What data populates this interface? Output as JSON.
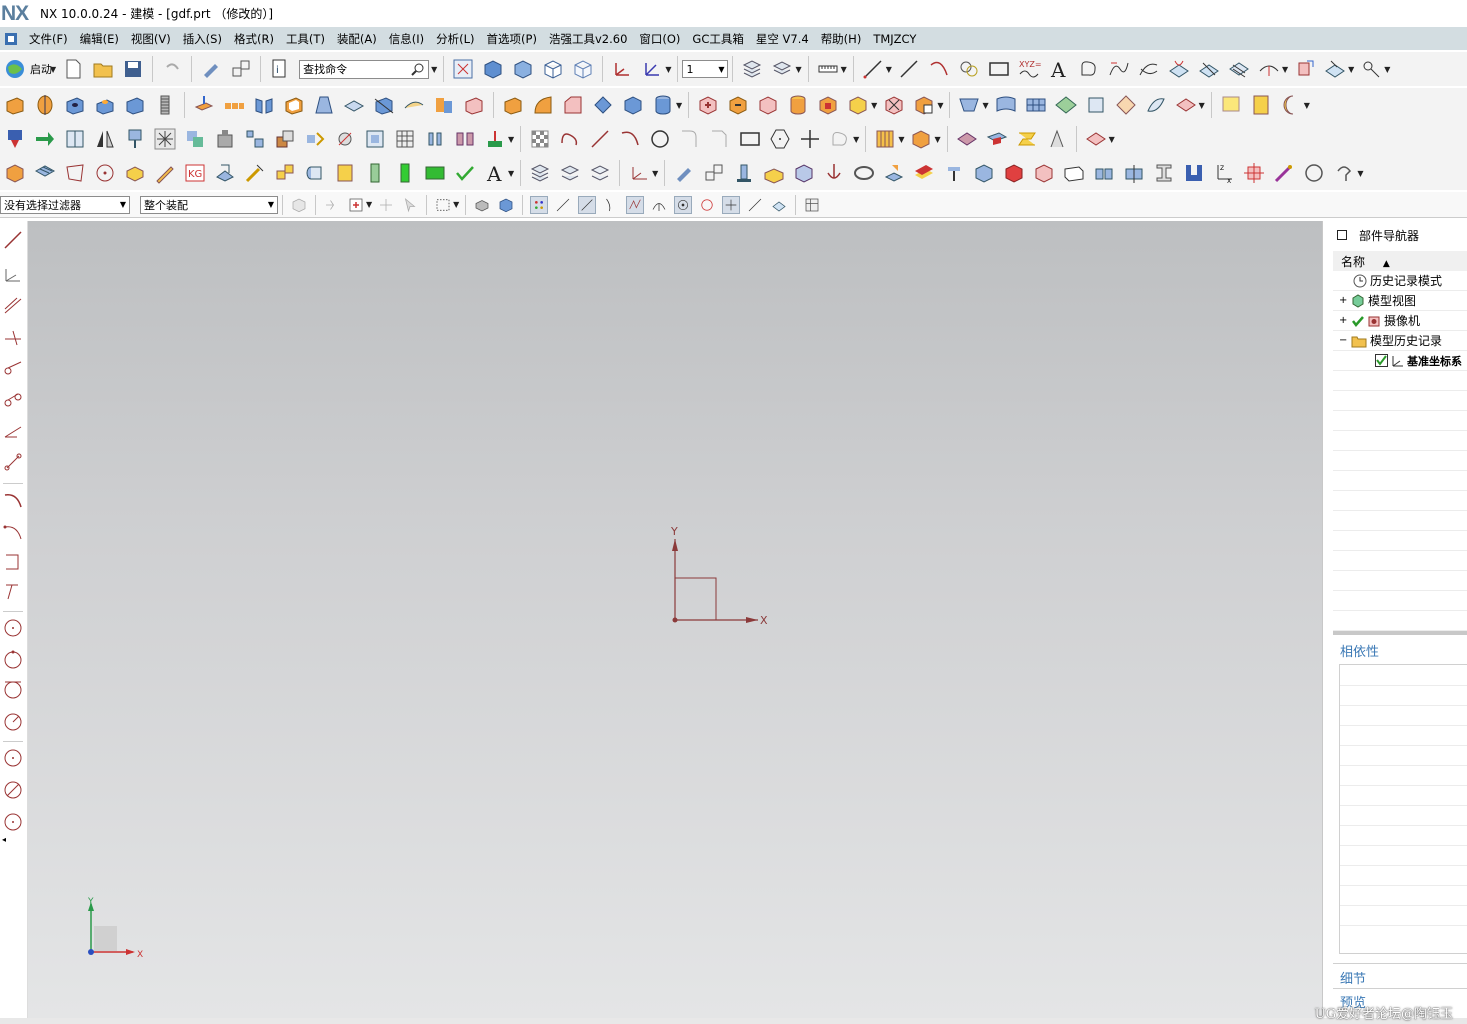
{
  "app": {
    "logo": "NX",
    "title": "NX 10.0.0.24 - 建模 - [gdf.prt （修改的）]"
  },
  "menubar": [
    "文件(F)",
    "编辑(E)",
    "视图(V)",
    "插入(S)",
    "格式(R)",
    "工具(T)",
    "装配(A)",
    "信息(I)",
    "分析(L)",
    "首选项(P)",
    "浩强工具v2.60",
    "窗口(O)",
    "GC工具箱",
    "星空 V7.4",
    "帮助(H)",
    "TMJZCY"
  ],
  "toolbar": {
    "start_label": "启动",
    "command_search_placeholder": "查找命令",
    "layer_value": "1"
  },
  "selection_bar": {
    "type_filter": "没有选择过滤器",
    "scope_filter": "整个装配"
  },
  "viewport": {
    "wcs_x_label": "X",
    "wcs_y_label": "Y",
    "triad_x_label": "X",
    "triad_y_label": "Y"
  },
  "navigator": {
    "title": "部件导航器",
    "column_name": "名称",
    "items": [
      {
        "label": "历史记录模式",
        "icon": "clock-icon"
      },
      {
        "label": "模型视图",
        "icon": "model-views-icon"
      },
      {
        "label": "摄像机",
        "icon": "camera-icon"
      },
      {
        "label": "模型历史记录",
        "icon": "folder-icon"
      },
      {
        "label": "基准坐标系",
        "icon": "datum-csys-icon"
      }
    ],
    "dependencies_title": "相依性",
    "details_title": "细节",
    "preview_title": "预览"
  },
  "watermark": "UG爱好者论坛@陶钰玉",
  "colors": {
    "menubar": "#d3dde1",
    "accent_blue": "#3a78b5",
    "wcs": "#8b3a3a",
    "logo": "#5b7f9e"
  }
}
